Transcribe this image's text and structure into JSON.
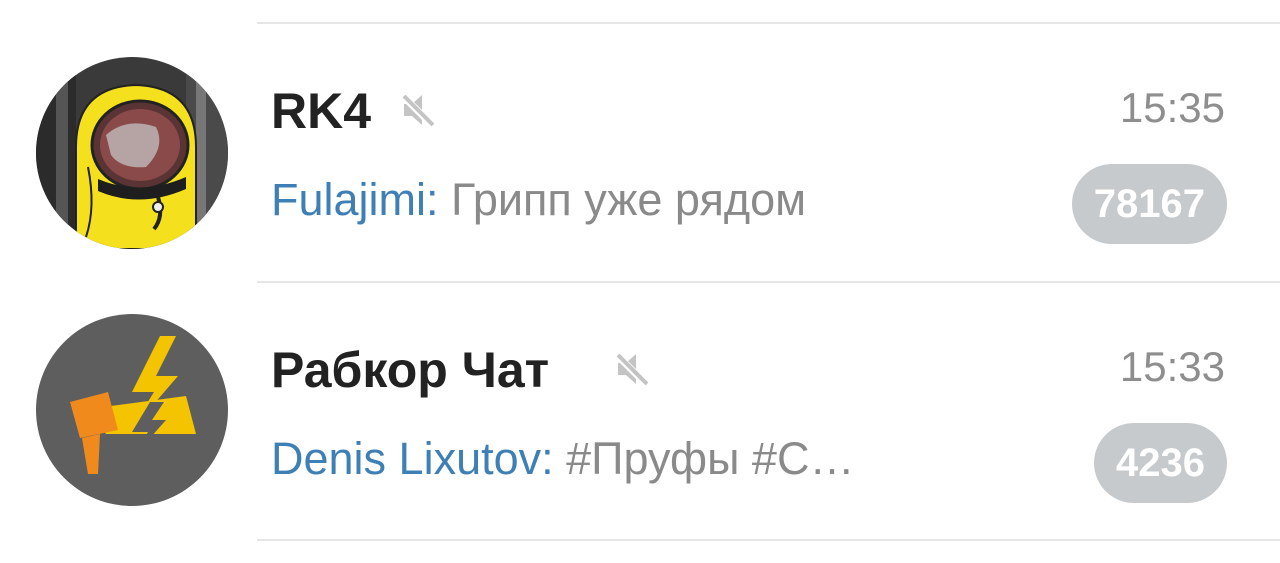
{
  "chats": [
    {
      "title": "RK4",
      "muted": true,
      "time": "15:35",
      "sender": "Fulajimi:",
      "message": "Грипп уже рядом",
      "unread": "78167"
    },
    {
      "title": "Рабкор Чат",
      "muted": true,
      "time": "15:33",
      "sender": "Denis Lixutov:",
      "message": "#Пруфы #С…",
      "unread": "4236"
    }
  ],
  "colors": {
    "sender": "#3e7fb6",
    "message": "#8a8a8a",
    "badge": "#c6cacd",
    "title": "#222222",
    "time": "#8e8e8e"
  },
  "icons": {
    "mute": "speaker-muted-icon"
  }
}
